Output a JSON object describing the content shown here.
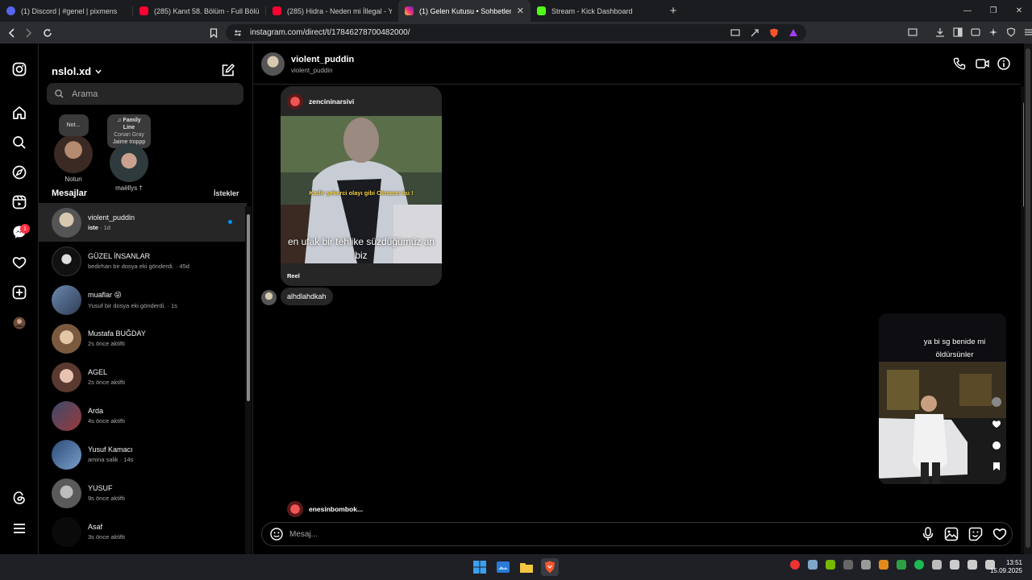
{
  "browser": {
    "tabs": [
      {
        "title": "(1) Discord | #genel | pixmens",
        "favicon": "discord-icon",
        "color": "#5865f2",
        "active": false
      },
      {
        "title": "(285) Kanıt 58. Bölüm - Full Bölüm - Y",
        "favicon": "youtube-icon",
        "color": "#ff0033",
        "active": false
      },
      {
        "title": "(285) Hidra - Neden mi İllegal - YouT",
        "favicon": "youtube-icon",
        "color": "#ff0033",
        "active": false
      },
      {
        "title": "(1) Gelen Kutusu • Sohbetler",
        "favicon": "instagram-icon",
        "color": "#e1306c",
        "active": true
      },
      {
        "title": "Stream - Kick Dashboard",
        "favicon": "kick-icon",
        "color": "#53fc18",
        "active": false
      }
    ],
    "new_tab": "+",
    "url": "instagram.com/direct/t/17846278700482000/"
  },
  "rail": {
    "notification_count": "1"
  },
  "inbox": {
    "account_name": "nslol.xd",
    "search_placeholder": "Arama",
    "notes": [
      {
        "bubble": "Not...",
        "name": "Notun"
      },
      {
        "bubble_song": "Family Line",
        "bubble_artist": "Conan Gray",
        "bubble_user": "Jaime troppp",
        "name": "maëllys †"
      }
    ],
    "messages_heading": "Mesajlar",
    "requests_label": "İstekler",
    "conversations": [
      {
        "name": "violent_puddin",
        "sub_bold": "iste",
        "sub": " · 1d",
        "unread": true,
        "selected": true
      },
      {
        "name": "GÜZEL İNSANLAR",
        "sub": "bedirhan bir dosya eki gönderdi. · 45d"
      },
      {
        "name": "muaflar 😜",
        "sub": "Yusuf bir dosya eki gönderdi. · 1s"
      },
      {
        "name": "Mustafa BUĞDAY",
        "sub": "2s önce aktifti"
      },
      {
        "name": "AGEL",
        "sub": "2s önce aktifti"
      },
      {
        "name": "Arda",
        "sub": "4s önce aktifti"
      },
      {
        "name": "Yusuf Kamacı",
        "sub": "amina salik · 14s"
      },
      {
        "name": "YUSUF",
        "sub": "9s önce aktifti"
      },
      {
        "name": "Asaf",
        "sub": "3s önce aktifti"
      }
    ]
  },
  "thread": {
    "name": "violent_puddin",
    "username": "violent_puddin",
    "shared_post": {
      "user": "zencininarsivi",
      "caption_top": "Kadir şekerci olayı gibi Olmasın bu !",
      "caption_main": "en ufak bir tehlike süzdüğümüz an biz",
      "footer": "Reel"
    },
    "text_message": "alhdlahdkah",
    "right_reel_caption": "ya bi sg benide mi öldürsünler",
    "peek_user": "enesinbombok...",
    "composer_placeholder": "Mesaj..."
  },
  "taskbar": {
    "time": "13:51",
    "date": "15.09.2025"
  }
}
